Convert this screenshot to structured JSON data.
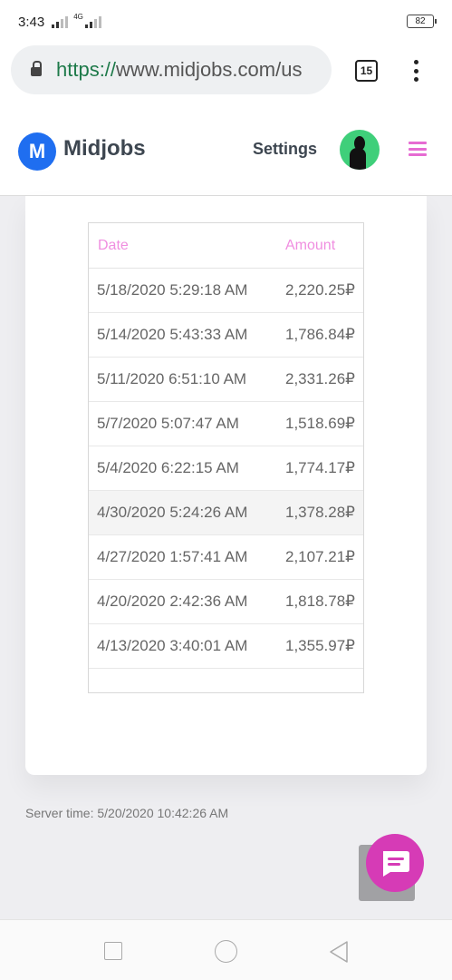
{
  "status_bar": {
    "time": "3:43",
    "network": "4G",
    "battery": "82"
  },
  "browser": {
    "url_scheme": "https://",
    "url_rest": "www.midjobs.com/us",
    "tab_count": "15"
  },
  "header": {
    "brand_letter": "M",
    "brand_name": "Midjobs",
    "settings_label": "Settings"
  },
  "table": {
    "headers": {
      "date": "Date",
      "amount": "Amount"
    },
    "rows": [
      {
        "date": "5/18/2020 5:29:18 AM",
        "amount": "2,220.25₽"
      },
      {
        "date": "5/14/2020 5:43:33 AM",
        "amount": "1,786.84₽"
      },
      {
        "date": "5/11/2020 6:51:10 AM",
        "amount": "2,331.26₽"
      },
      {
        "date": "5/7/2020 5:07:47 AM",
        "amount": "1,518.69₽"
      },
      {
        "date": "5/4/2020 6:22:15 AM",
        "amount": "1,774.17₽"
      },
      {
        "date": "4/30/2020 5:24:26 AM",
        "amount": "1,378.28₽"
      },
      {
        "date": "4/27/2020 1:57:41 AM",
        "amount": "2,107.21₽"
      },
      {
        "date": "4/20/2020 2:42:36 AM",
        "amount": "1,818.78₽"
      },
      {
        "date": "4/13/2020 3:40:01 AM",
        "amount": "1,355.97₽"
      }
    ]
  },
  "footer": {
    "server_time": "Server time: 5/20/2020 10:42:26 AM"
  },
  "icons": {
    "lock": "lock-icon",
    "chat": "chat-icon",
    "menu": "hamburger-menu-icon"
  },
  "colors": {
    "brand_blue": "#1f6ef0",
    "accent_pink": "#e66bd2",
    "chat_magenta": "#d63bb6",
    "url_green": "#1e7a4a"
  }
}
